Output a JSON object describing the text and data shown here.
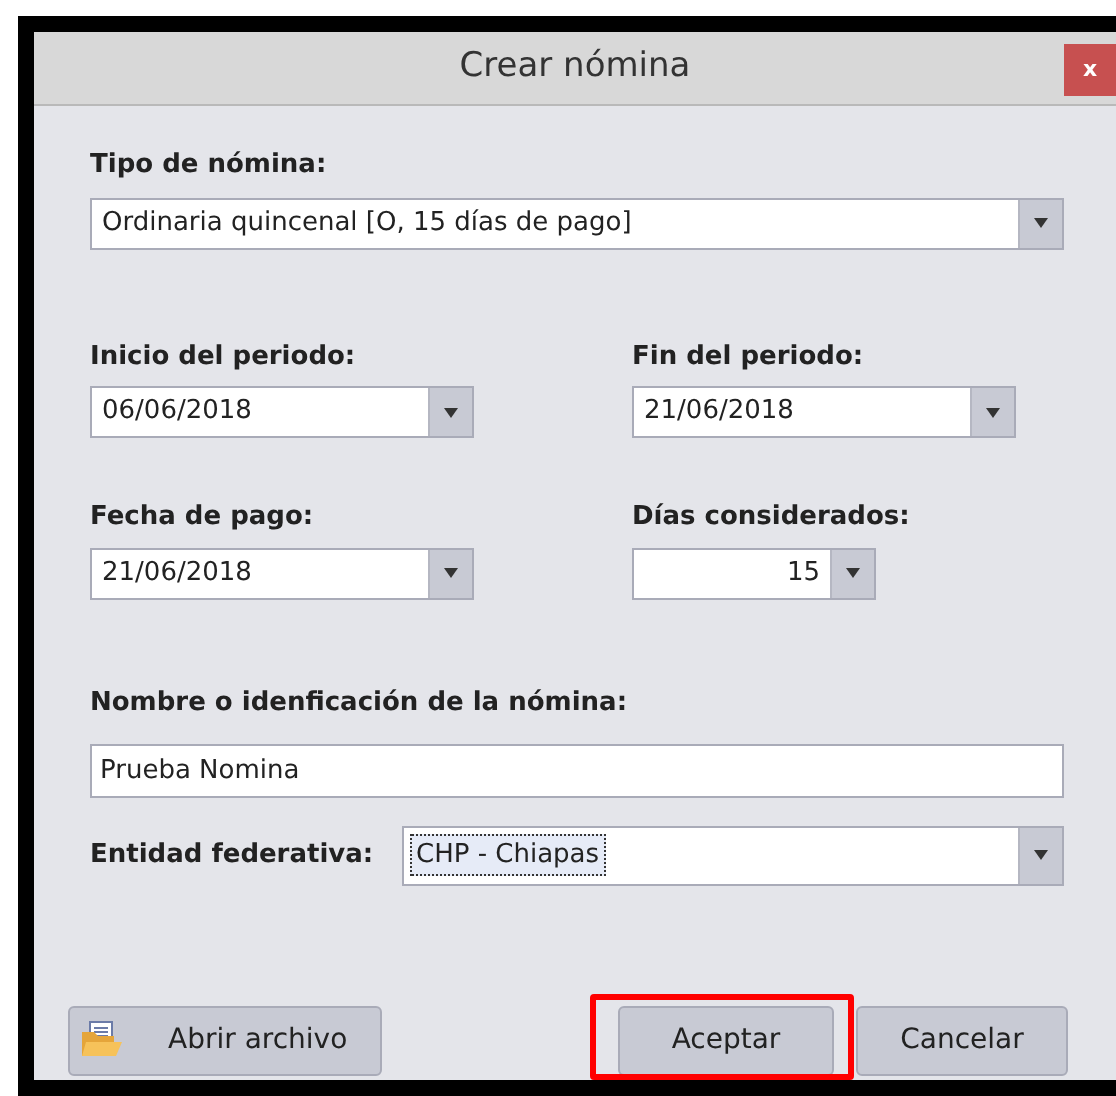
{
  "window": {
    "title": "Crear nómina",
    "close": "x"
  },
  "tipo": {
    "label": "Tipo de nómina:",
    "value": "Ordinaria quincenal [O, 15 días de pago]"
  },
  "inicio": {
    "label": "Inicio del periodo:",
    "value": "06/06/2018"
  },
  "fin": {
    "label": "Fin del periodo:",
    "value": "21/06/2018"
  },
  "fecha_pago": {
    "label": "Fecha de pago:",
    "value": "21/06/2018"
  },
  "dias": {
    "label": "Días considerados:",
    "value": "15"
  },
  "nombre": {
    "label": "Nombre o idenficación de la nómina:",
    "value": "Prueba Nomina"
  },
  "entidad": {
    "label": "Entidad federativa:",
    "value": "CHP - Chiapas",
    "focused": true
  },
  "buttons": [
    {
      "label": "Abrir archivo",
      "kind": "open",
      "highlighted": false
    },
    {
      "label": "Aceptar",
      "kind": "plain",
      "highlighted": true
    },
    {
      "label": "Cancelar",
      "kind": "plain",
      "highlighted": false
    }
  ]
}
